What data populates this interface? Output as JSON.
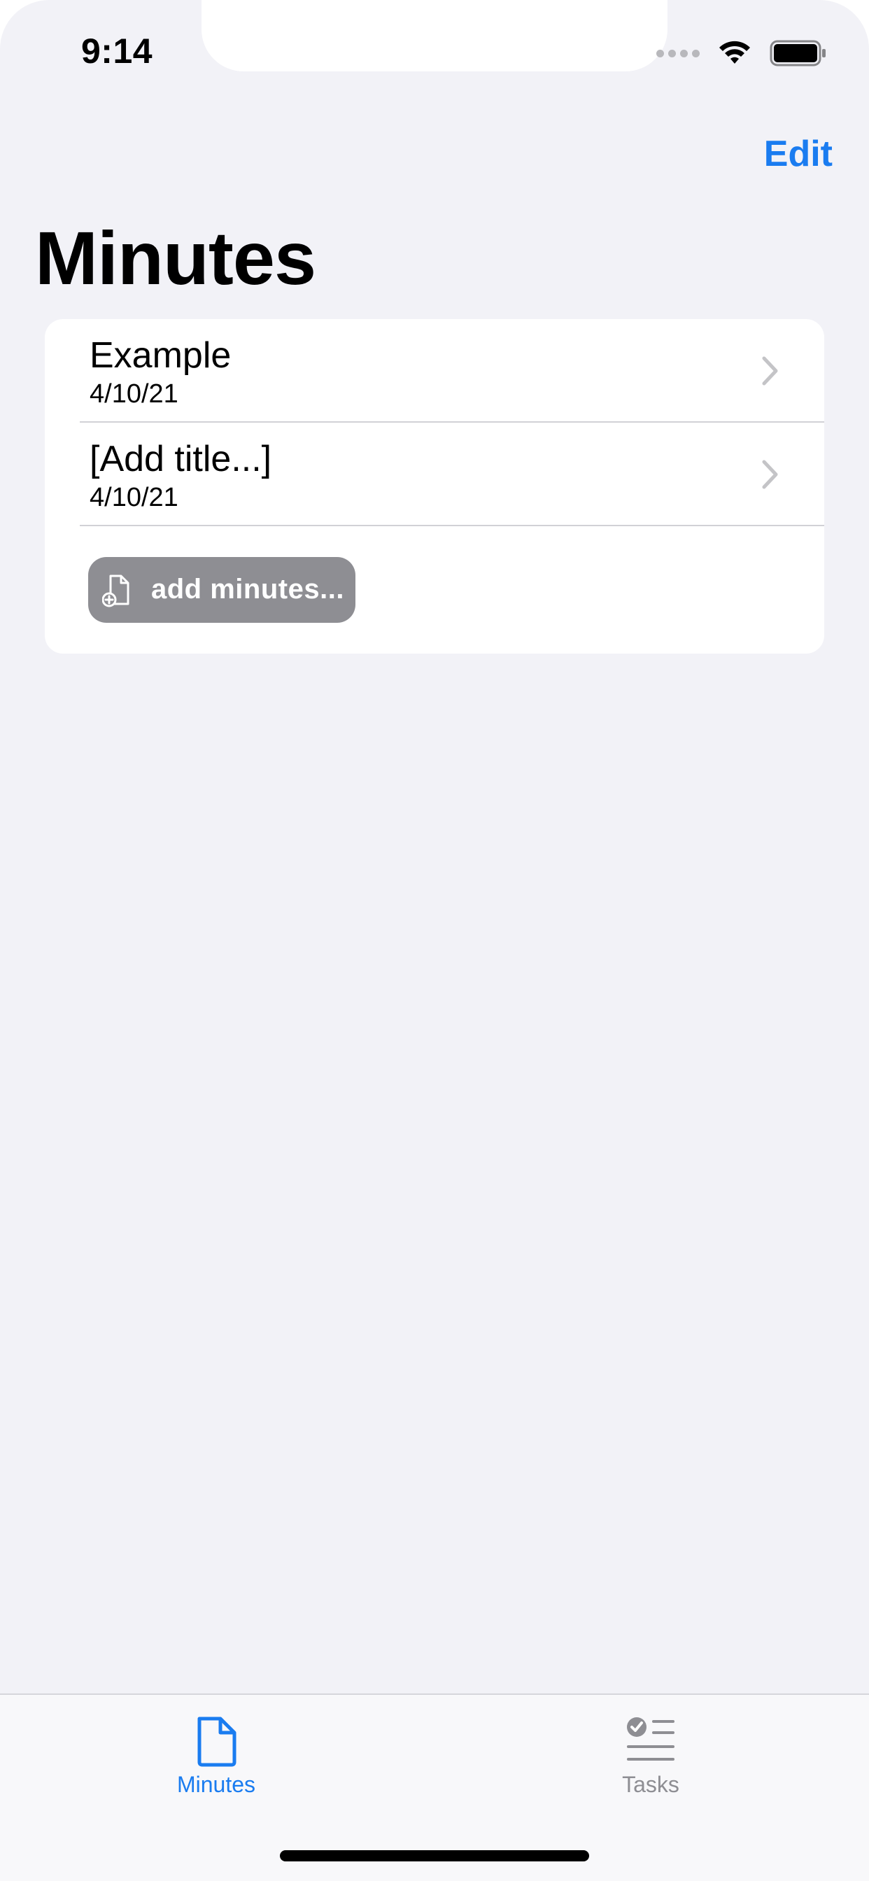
{
  "status_bar": {
    "time": "9:14"
  },
  "nav": {
    "edit_label": "Edit",
    "title": "Minutes"
  },
  "minutes_list": [
    {
      "title": "Example",
      "date": "4/10/21"
    },
    {
      "title": "[Add title...]",
      "date": "4/10/21"
    }
  ],
  "add_button": {
    "label": "add minutes..."
  },
  "tab_bar": {
    "items": [
      {
        "label": "Minutes",
        "icon": "document-icon",
        "selected": true
      },
      {
        "label": "Tasks",
        "icon": "checklist-icon",
        "selected": false
      }
    ]
  },
  "colors": {
    "accent": "#1a7cf0",
    "background": "#f2f2f7",
    "button_gray": "#8e8e93"
  }
}
